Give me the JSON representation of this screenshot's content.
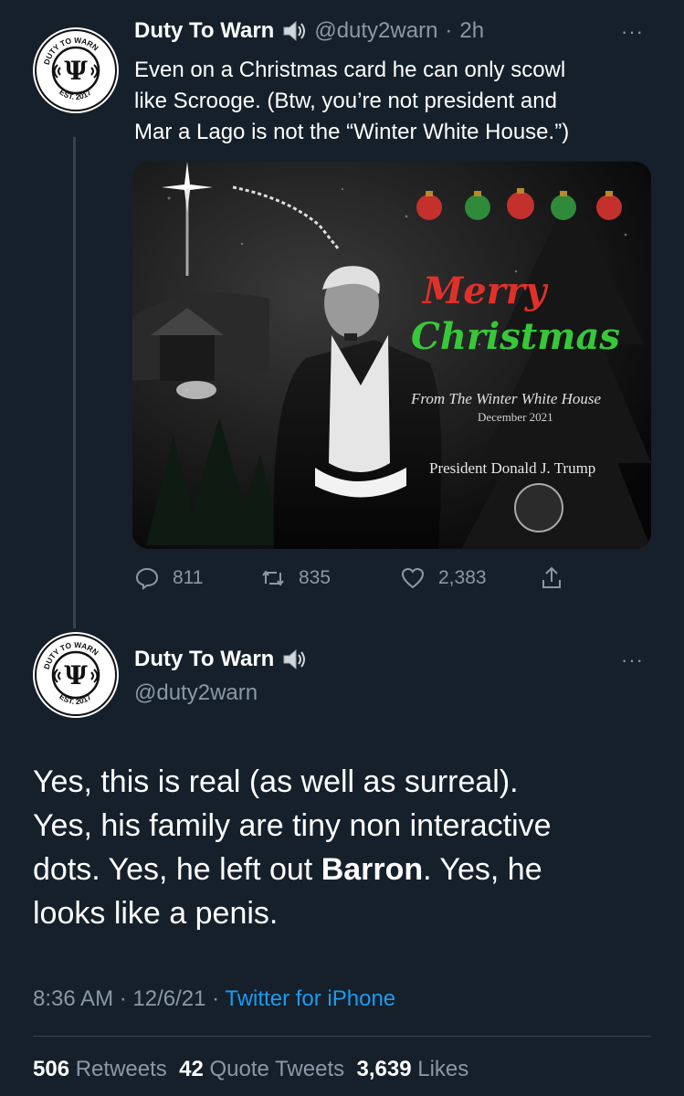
{
  "tweet1": {
    "display_name": "Duty To Warn",
    "handle": "@duty2warn",
    "separator": "·",
    "time": "2h",
    "more": "···",
    "text_lines": [
      "Even on a Christmas card he can only scowl",
      "like Scrooge. (Btw, you’re not president and",
      "Mar a Lago is not the “Winter White House.”)"
    ],
    "card": {
      "merry": "Merry",
      "christmas": "Christmas",
      "from": "From The Winter White House",
      "date": "December 2021",
      "signature": "President Donald J. Trump"
    },
    "actions": {
      "replies": "811",
      "retweets": "835",
      "likes": "2,383"
    }
  },
  "tweet2": {
    "display_name": "Duty To Warn",
    "handle": "@duty2warn",
    "more": "···",
    "text": {
      "line1": "Yes, this is real (as well as surreal).",
      "line2": "Yes, his family are tiny non interactive",
      "line3_a": "dots. Yes, he left out ",
      "line3_bold": "Barron",
      "line3_b": ". Yes, he",
      "line4": "looks like a penis."
    },
    "meta": {
      "time": "8:36 AM",
      "dot": "·",
      "date": "12/6/21",
      "source": "Twitter for iPhone"
    },
    "stats": {
      "retweets_count": "506",
      "retweets_label": "Retweets",
      "quotes_count": "42",
      "quotes_label": "Quote Tweets",
      "likes_count": "3,639",
      "likes_label": "Likes"
    }
  },
  "avatar": {
    "top_text": "DUTY TO WARN",
    "bottom_text": "EST. 2017"
  },
  "colors": {
    "background": "#15202b",
    "secondary_text": "#8b98a5",
    "link": "#1d9bf0",
    "divider": "#38444d",
    "merry_red": "#e0302a",
    "christmas_green": "#37c83a"
  }
}
